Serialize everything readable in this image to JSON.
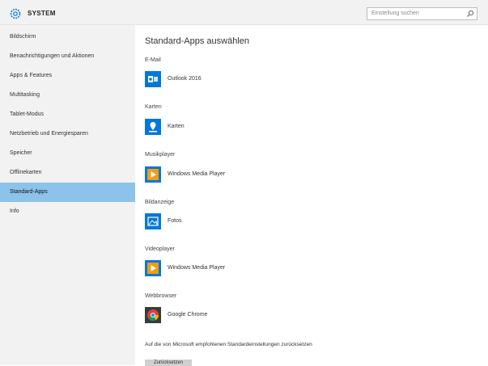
{
  "window": {
    "title": "SYSTEM",
    "search_placeholder": "Einstellung suchen"
  },
  "sidebar": {
    "items": [
      {
        "label": "Bildschirm"
      },
      {
        "label": "Benachrichtigungen und Aktionen"
      },
      {
        "label": "Apps & Features"
      },
      {
        "label": "Multitasking"
      },
      {
        "label": "Tablet-Modus"
      },
      {
        "label": "Netzbetrieb und Energiesparen"
      },
      {
        "label": "Speicher"
      },
      {
        "label": "Offlinekarten"
      },
      {
        "label": "Standard-Apps",
        "selected": true
      },
      {
        "label": "Info"
      }
    ]
  },
  "main": {
    "title": "Standard-Apps auswählen",
    "sections": [
      {
        "label": "E-Mail",
        "app": "Outlook 2016",
        "icon": "outlook-icon"
      },
      {
        "label": "Karten",
        "app": "Karten",
        "icon": "maps-icon"
      },
      {
        "label": "Musikplayer",
        "app": "Windows Media Player",
        "icon": "media-player-icon"
      },
      {
        "label": "Bildanzeige",
        "app": "Fotos",
        "icon": "photos-icon"
      },
      {
        "label": "Videoplayer",
        "app": "Windows Media Player",
        "icon": "media-player-icon"
      },
      {
        "label": "Webbrowser",
        "app": "Google Chrome",
        "icon": "chrome-icon"
      }
    ],
    "reset_text": "Auf die von Microsoft empfohlenen Standardeinstellungen zurücksetzen",
    "reset_button_label": "Zurücksetzen"
  },
  "colors": {
    "accent": "#0078d7",
    "selected_nav": "#8cc3ea",
    "sidebar_bg": "#f2f2f2"
  }
}
